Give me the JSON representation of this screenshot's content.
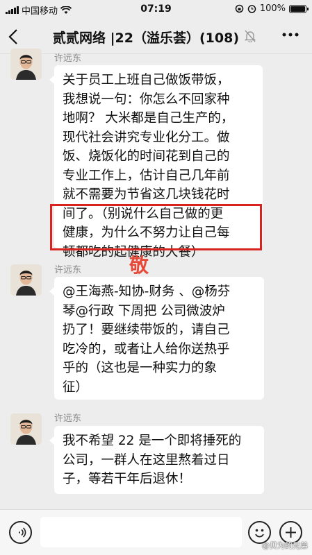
{
  "status_bar": {
    "carrier": "中国移动",
    "time": "07:19",
    "battery": "100%"
  },
  "nav": {
    "back_icon": "chevron-left-icon",
    "title": "贰贰网络 |22（溢乐荟）(108)",
    "more_icon": "more-dots-icon"
  },
  "messages": [
    {
      "sender": "许远东",
      "lines": [
        "关于员工上班自己做饭带饭，",
        "我想说一句：你怎么不回家种",
        "地啊？ 大米都是自己生产的，",
        "现代社会讲究专业化分工。做",
        "饭、烧饭化的时间花到自己的",
        "专业工作上，估计自己几年前",
        "就不需要为节省这几块钱花时",
        "间了。（别说什么自己做的更",
        "健康，为什么不努力让自己每",
        "顿都吃的起健康的大餐）"
      ]
    },
    {
      "sender": "许远东",
      "lines": [
        "@王海燕-知协-财务 、@杨芬",
        "琴@行政  下周把 公司微波炉",
        "扔了！要继续带饭的，请自己",
        "吃冷的，或者让人给你送热乎",
        "乎的（这也是一种实力的象",
        "征）"
      ]
    },
    {
      "sender": "许远东",
      "lines": [
        "我不希望 22 是一个即将捶死的",
        "公司，一群人在这里熬着过日",
        "子，等若干年后退休！"
      ]
    }
  ],
  "overlay": {
    "stamp_text": "敬"
  },
  "input_bar": {
    "placeholder": "",
    "voice_icon": "voice-icon",
    "emoji_icon": "emoji-icon",
    "plus_icon": "plus-icon"
  },
  "watermark": "@贝为的兄弟"
}
